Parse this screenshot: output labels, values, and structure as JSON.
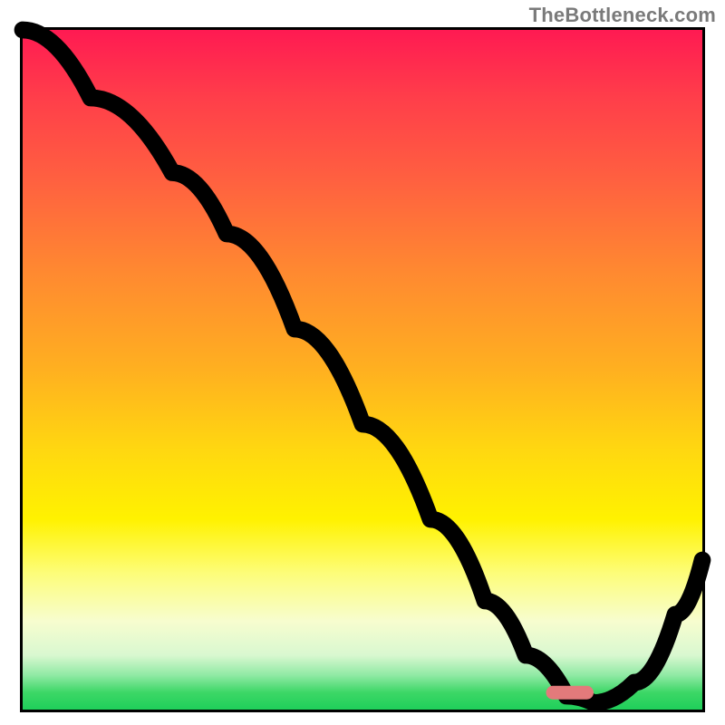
{
  "watermark": "TheBottleneck.com",
  "chart_data": {
    "type": "line",
    "title": "",
    "xlabel": "",
    "ylabel": "",
    "xlim": [
      0,
      100
    ],
    "ylim": [
      0,
      100
    ],
    "grid": false,
    "legend": false,
    "gradient_meaning": "background hue maps to y: green≈0 (good/low bottleneck), yellow mid, red≈100 (bad/high)",
    "series": [
      {
        "name": "bottleneck-curve",
        "x": [
          0,
          10,
          22,
          30,
          40,
          50,
          60,
          68,
          74,
          80,
          84,
          90,
          96,
          100
        ],
        "values": [
          100,
          90,
          79,
          70,
          56,
          42,
          28,
          16,
          8,
          2,
          1,
          4,
          14,
          22
        ]
      }
    ],
    "marker": {
      "name": "optimal-region",
      "shape": "rounded-bar",
      "color": "#e37a7b",
      "x_range": [
        77,
        84
      ],
      "y": 2
    }
  }
}
